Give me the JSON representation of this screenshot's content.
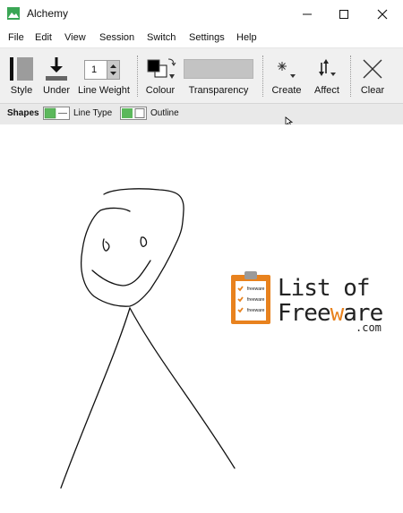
{
  "window": {
    "title": "Alchemy"
  },
  "menu": [
    "File",
    "Edit",
    "View",
    "Session",
    "Switch",
    "Settings",
    "Help"
  ],
  "toolbar": {
    "style": "Style",
    "under": "Under",
    "line_weight_label": "Line Weight",
    "line_weight_value": "1",
    "colour": "Colour",
    "transparency": "Transparency",
    "create": "Create",
    "affect": "Affect",
    "clear": "Clear"
  },
  "subbar": {
    "shapes": "Shapes",
    "line_type": "Line Type",
    "outline": "Outline"
  },
  "watermark": {
    "line1": "List of",
    "line2a": "Free",
    "line2b": "w",
    "line2c": "are",
    "line3": ".com",
    "clipboard_items": [
      "freeware",
      "freeware",
      "freeware"
    ]
  },
  "colors": {
    "accent_green": "#5cb85c",
    "foreground_color": "#000000",
    "watermark_orange": "#e8821e"
  }
}
